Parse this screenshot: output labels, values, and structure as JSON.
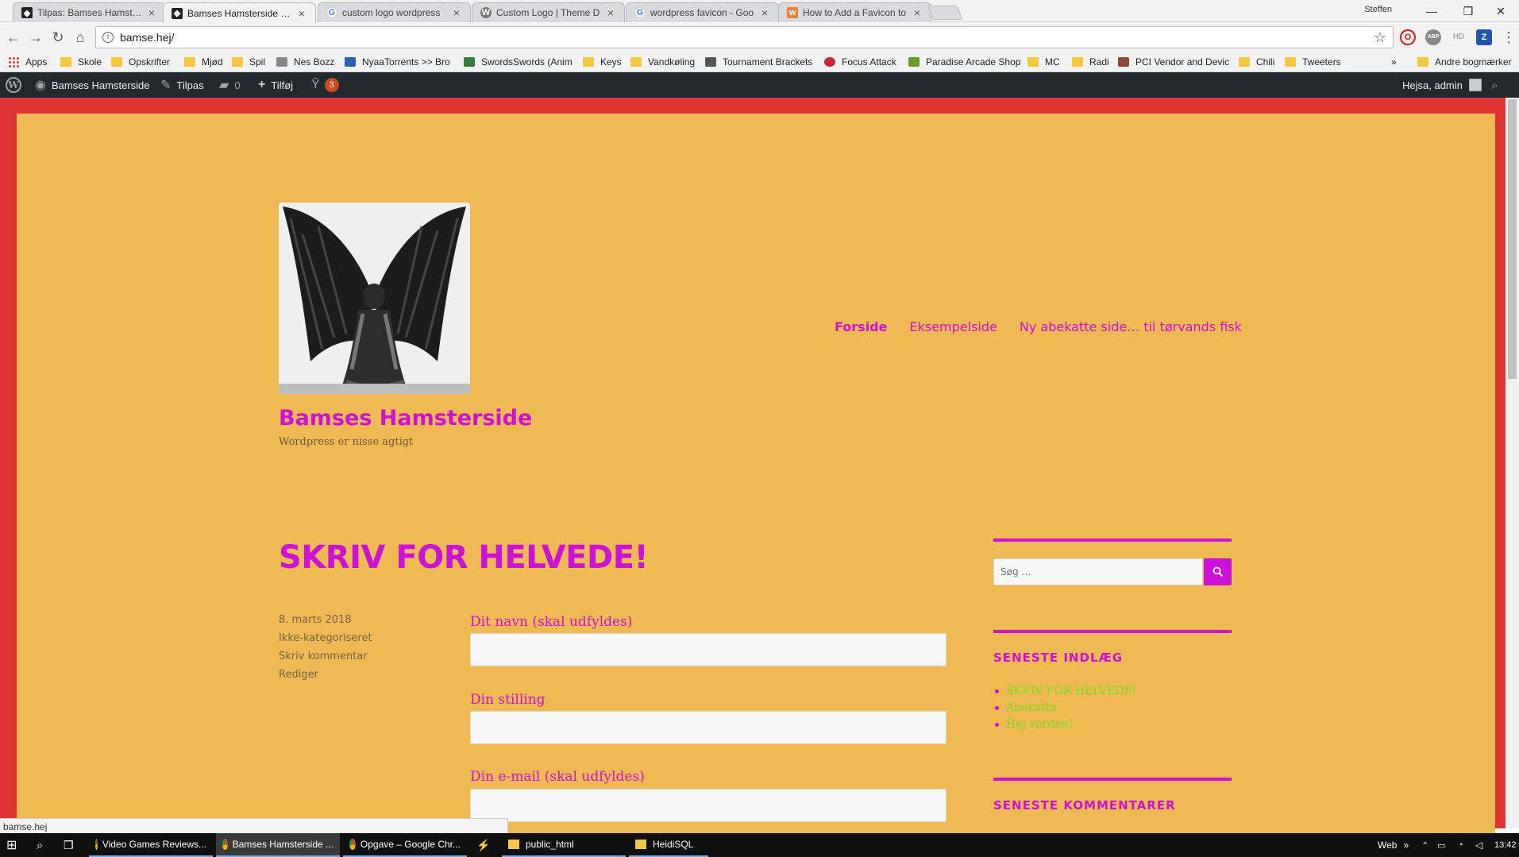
{
  "browser": {
    "tabs": [
      {
        "title": "Tilpas: Bamses Hamsterside",
        "icon": "site-favicon",
        "active": false
      },
      {
        "title": "Bamses Hamsterside - W",
        "icon": "site-favicon",
        "active": true
      },
      {
        "title": "custom logo wordpress",
        "icon": "google-icon",
        "active": false
      },
      {
        "title": "Custom Logo | Theme D",
        "icon": "wordpress-icon",
        "active": false
      },
      {
        "title": "wordpress favicon - Goo",
        "icon": "google-icon",
        "active": false
      },
      {
        "title": "How to Add a Favicon to",
        "icon": "wpbeginner-icon",
        "active": false
      }
    ],
    "profile_name": "Steffen",
    "url": "bamse.hej/",
    "extensions": [
      "O",
      "ABP",
      "HD",
      "Z"
    ],
    "bookmarks": [
      {
        "label": "Apps",
        "icon": "apps"
      },
      {
        "label": "Skole",
        "icon": "folder"
      },
      {
        "label": "Opskrifter",
        "icon": "folder"
      },
      {
        "label": "Mjød",
        "icon": "folder"
      },
      {
        "label": "Spil",
        "icon": "folder"
      },
      {
        "label": "Nes Bozz",
        "icon": "other"
      },
      {
        "label": "NyaaTorrents >> Bro",
        "icon": "other"
      },
      {
        "label": "SwordsSwords (Anim",
        "icon": "other"
      },
      {
        "label": "Keys",
        "icon": "folder"
      },
      {
        "label": "Vandkøling",
        "icon": "folder"
      },
      {
        "label": "Tournament Brackets",
        "icon": "other"
      },
      {
        "label": "Focus Attack",
        "icon": "other"
      },
      {
        "label": "Paradise Arcade Shop",
        "icon": "other"
      },
      {
        "label": "MC",
        "icon": "folder"
      },
      {
        "label": "Radi",
        "icon": "folder"
      },
      {
        "label": "PCI Vendor and Devic",
        "icon": "other"
      },
      {
        "label": "Chili",
        "icon": "folder"
      },
      {
        "label": "Tweeters",
        "icon": "folder"
      }
    ],
    "more_bookmarks": "»",
    "other_bookmarks": "Andre bogmærker",
    "status_url": "bamse.hej"
  },
  "adminbar": {
    "site_name": "Bamses Hamsterside",
    "customize": "Tilpas",
    "comments_count": "0",
    "new_label": "Tilføj",
    "yoast_count": "3",
    "greeting": "Hejsa, admin"
  },
  "site": {
    "title": "Bamses Hamsterside",
    "tagline": "Wordpress er nisse agtigt",
    "menu": [
      {
        "label": "Forside",
        "current": true
      },
      {
        "label": "Eksempelside",
        "current": false
      },
      {
        "label": "Ny abekatte side… til tørvands fisk",
        "current": false
      }
    ]
  },
  "post": {
    "title": "SKRIV FOR HELVEDE!",
    "meta": {
      "date": "8. marts 2018",
      "category": "Ikke-kategoriseret",
      "comment": "Skriv kommentar",
      "edit": "Rediger"
    },
    "form": {
      "name_label": "Dit navn (skal udfyldes)",
      "title_label": "Din stilling",
      "email_label": "Din e-mail (skal udfyldes)"
    }
  },
  "sidebar": {
    "search_placeholder": "Søg …",
    "recent_posts_title": "SENESTE INDLÆG",
    "recent_posts": [
      "SKRIV FOR HELVEDE!",
      "Abekatte",
      "Hej verden!"
    ],
    "recent_comments_title": "SENESTE KOMMENTARER"
  },
  "taskbar": {
    "apps": [
      {
        "label": "Video Games Reviews...",
        "icon": "chrome"
      },
      {
        "label": "Bamses Hamsterside ...",
        "icon": "chrome"
      },
      {
        "label": "Opgave – Google Chr...",
        "icon": "chrome"
      },
      {
        "label": "public_html",
        "icon": "folder"
      },
      {
        "label": "HeidiSQL",
        "icon": "folder"
      }
    ],
    "web_label": "Web",
    "time": "13:42"
  },
  "colors": {
    "accent": "#cc11d8",
    "site_background": "#efb954",
    "frame": "#e03535",
    "link_green": "#7ae01c",
    "admin_bar": "#23282d"
  }
}
